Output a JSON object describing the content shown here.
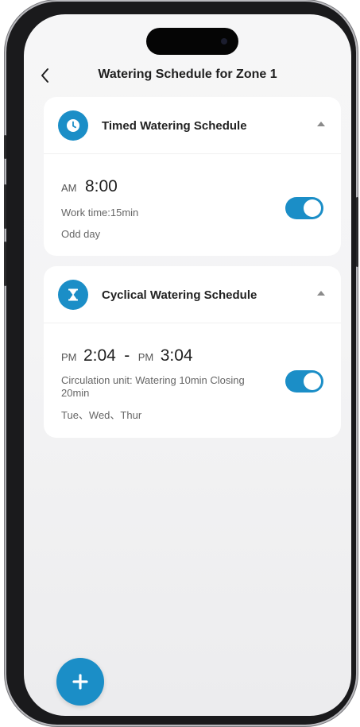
{
  "header": {
    "title": "Watering Schedule for Zone 1",
    "back_icon": "chevron-left-icon"
  },
  "schedules": [
    {
      "title": "Timed Watering Schedule",
      "icon": "clock-icon",
      "expanded": true,
      "start_period": "AM",
      "start_time": "8:00",
      "detail": "Work time:15min",
      "days": "Odd day",
      "enabled": true
    },
    {
      "title": "Cyclical Watering Schedule",
      "icon": "hourglass-icon",
      "expanded": true,
      "start_period": "PM",
      "start_time": "2:04",
      "separator": "-",
      "end_period": "PM",
      "end_time": "3:04",
      "detail": "Circulation unit: Watering 10min Closing 20min",
      "days": "Tue、Wed、Thur",
      "enabled": true
    }
  ],
  "fab": {
    "icon": "plus-icon"
  },
  "colors": {
    "accent": "#1b8ec7",
    "background": "#f5f5f6",
    "card": "#ffffff",
    "text_primary": "#1f1f1f",
    "text_secondary": "#666666"
  }
}
